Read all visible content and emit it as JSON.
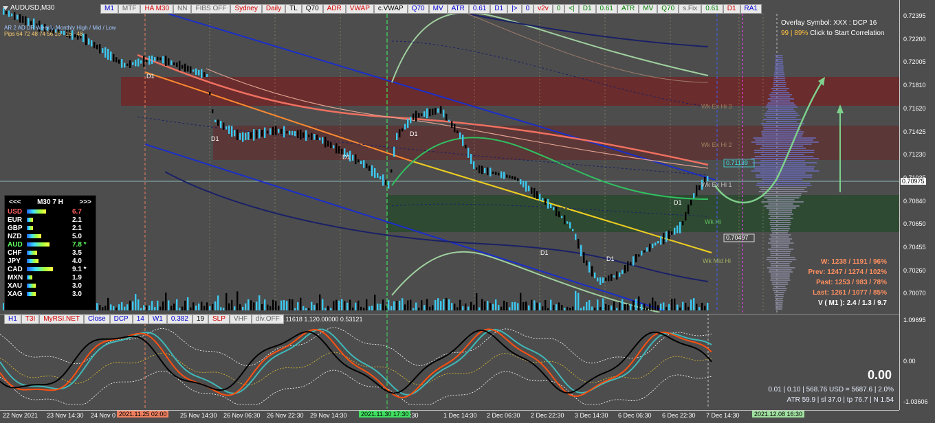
{
  "symbol": "AUDUSD,M30",
  "toolbar": [
    {
      "label": "M1",
      "c": ""
    },
    {
      "label": "MTF",
      "c": "gray"
    },
    {
      "label": "HA M30",
      "c": "red"
    },
    {
      "label": "NN",
      "c": "gray"
    },
    {
      "label": "FIBS OFF",
      "c": "gray"
    },
    {
      "label": "Sydney",
      "c": "red"
    },
    {
      "label": "Daily",
      "c": "red"
    },
    {
      "label": "TL",
      "c": "black"
    },
    {
      "label": "Q70",
      "c": "black"
    },
    {
      "label": "ADR",
      "c": "red"
    },
    {
      "label": "VWAP",
      "c": "red"
    },
    {
      "label": "c.VWAP",
      "c": "black"
    },
    {
      "label": "Q70",
      "c": ""
    },
    {
      "label": "MV",
      "c": ""
    },
    {
      "label": "ATR",
      "c": ""
    },
    {
      "label": "0.61",
      "c": ""
    },
    {
      "label": "D1",
      "c": ""
    },
    {
      "label": "|>",
      "c": ""
    },
    {
      "label": "0",
      "c": ""
    },
    {
      "label": "v2v",
      "c": "red"
    },
    {
      "label": "0",
      "c": "green"
    },
    {
      "label": "<|",
      "c": "green"
    },
    {
      "label": "D1",
      "c": "green"
    },
    {
      "label": "0.61",
      "c": "green"
    },
    {
      "label": "ATR",
      "c": "green"
    },
    {
      "label": "MV",
      "c": "green"
    },
    {
      "label": "Q70",
      "c": "green"
    },
    {
      "label": "s.Fix",
      "c": "gray"
    },
    {
      "label": "0.61",
      "c": "green"
    },
    {
      "label": "D1",
      "c": "red"
    },
    {
      "label": "RA1",
      "c": ""
    }
  ],
  "ind_toolbar": [
    {
      "label": "H1",
      "c": ""
    },
    {
      "label": "T3I",
      "c": "red"
    },
    {
      "label": "MyRSI.NET",
      "c": "red"
    },
    {
      "label": "Close",
      "c": ""
    },
    {
      "label": "DCP",
      "c": ""
    },
    {
      "label": "14",
      "c": ""
    },
    {
      "label": "W1",
      "c": ""
    },
    {
      "label": "0.382",
      "c": ""
    },
    {
      "label": "19",
      "c": "black"
    },
    {
      "label": "SLP",
      "c": "red"
    },
    {
      "label": "VHF",
      "c": "gray"
    },
    {
      "label": "div.OFF",
      "c": "gray"
    }
  ],
  "ind_values": "1.11618  1.120.00000  0.53121",
  "top_stats": {
    "row1": "AR  2 AD DR      Weekly    Monthly    High / Mid / Low",
    "row2": "Pips  64  72    48    74    56       16 · 16 · 48"
  },
  "price_ticks": [
    "0.72395",
    "0.72200",
    "0.72005",
    "0.71810",
    "0.71620",
    "0.71425",
    "0.71230",
    "0.71035",
    "0.70840",
    "0.70650",
    "0.70455",
    "0.70260",
    "0.70070"
  ],
  "current_price": "0.70975",
  "sub_ticks": [
    "1.09695",
    "0.00",
    "-1.03606"
  ],
  "time_ticks": [
    "22 Nov 2021",
    "23 Nov 14:30",
    "24 Nov 0",
    "25 Nov 14:30",
    "26 Nov 06:30",
    "26 Nov 22:30",
    "29 Nov 14:30",
    "ov 22:30",
    "1 Dec 14:30",
    "2 Dec 06:30",
    "2 Dec 22:30",
    "3 Dec 14:30",
    "6 Dec 06:30",
    "6 Dec 22:30",
    "7 Dec 14:30"
  ],
  "time_marks": [
    {
      "label": "2021.11.25 02:00",
      "color": "#f08060"
    },
    {
      "label": "2021.11.30 17:30",
      "color": "#40e060"
    },
    {
      "label": "2021.12.08 16:30",
      "color": "#a0e0a0"
    }
  ],
  "chart_labels": {
    "wk_ex_hi_3": "Wk Ex Hi 3",
    "wk_ex_hi_2": "Wk Ex Hi 2",
    "wk_ex_hi_1": "Wk Ex Hi 1",
    "wk_hi": "Wk Hi",
    "wk_mid_hi": "Wk Mid Hi",
    "price_box_1": "0.71139",
    "price_box_2": "0.70497",
    "d1": "D1"
  },
  "strength": {
    "header_left": "<<<",
    "header_mid": "M30  7  H",
    "header_right": ">>>",
    "rows": [
      {
        "cur": "USD",
        "val": "6.7",
        "color": "#ff6060",
        "bar": 67
      },
      {
        "cur": "EUR",
        "val": "2.1",
        "color": "#ffffff",
        "bar": 21
      },
      {
        "cur": "GBP",
        "val": "2.1",
        "color": "#ffffff",
        "bar": 21
      },
      {
        "cur": "NZD",
        "val": "5.0",
        "color": "#ffffff",
        "bar": 50
      },
      {
        "cur": "AUD",
        "val": "7.8 *",
        "color": "#60ff60",
        "bar": 78
      },
      {
        "cur": "CHF",
        "val": "3.5",
        "color": "#ffffff",
        "bar": 35
      },
      {
        "cur": "JPY",
        "val": "4.0",
        "color": "#ffffff",
        "bar": 40
      },
      {
        "cur": "CAD",
        "val": "9.1 *",
        "color": "#ffffff",
        "bar": 91
      },
      {
        "cur": "MXN",
        "val": "1.9",
        "color": "#ffffff",
        "bar": 19
      },
      {
        "cur": "XAU",
        "val": "3.0",
        "color": "#ffffff",
        "bar": 30
      },
      {
        "cur": "XAG",
        "val": "3.0",
        "color": "#ffffff",
        "bar": 30
      }
    ]
  },
  "overlay": {
    "line1": "Overlay Symbol: XXX : DCP 16",
    "line2_a": "99 | 89%",
    "line2_b": " Click to Start Correlation"
  },
  "stats": {
    "w": "W: 1238 / 1191 / 96%",
    "prev": "Prev: 1247 / 1274 / 102%",
    "past": "Past: 1253 / 983 / 78%",
    "last": "Last: 1261 / 1077 / 85%",
    "v": "V ( M1 ): 2.4 / 1.3 / 9.7"
  },
  "big_value": "0.00",
  "account": {
    "line1": "0.01  |  0.10  |  568.76 USD = 5687.6  |  2.0%",
    "line2": "ATR 59.9  | sl 37.0  |  tp 76.7  |  N 1.54"
  },
  "colors": {
    "bg": "#4d4d4d",
    "bull": "#3cc8f0",
    "bear": "#000000",
    "supply": "#6b2a2a",
    "demand": "#2d4a32",
    "trend": "#1a2ecc"
  }
}
